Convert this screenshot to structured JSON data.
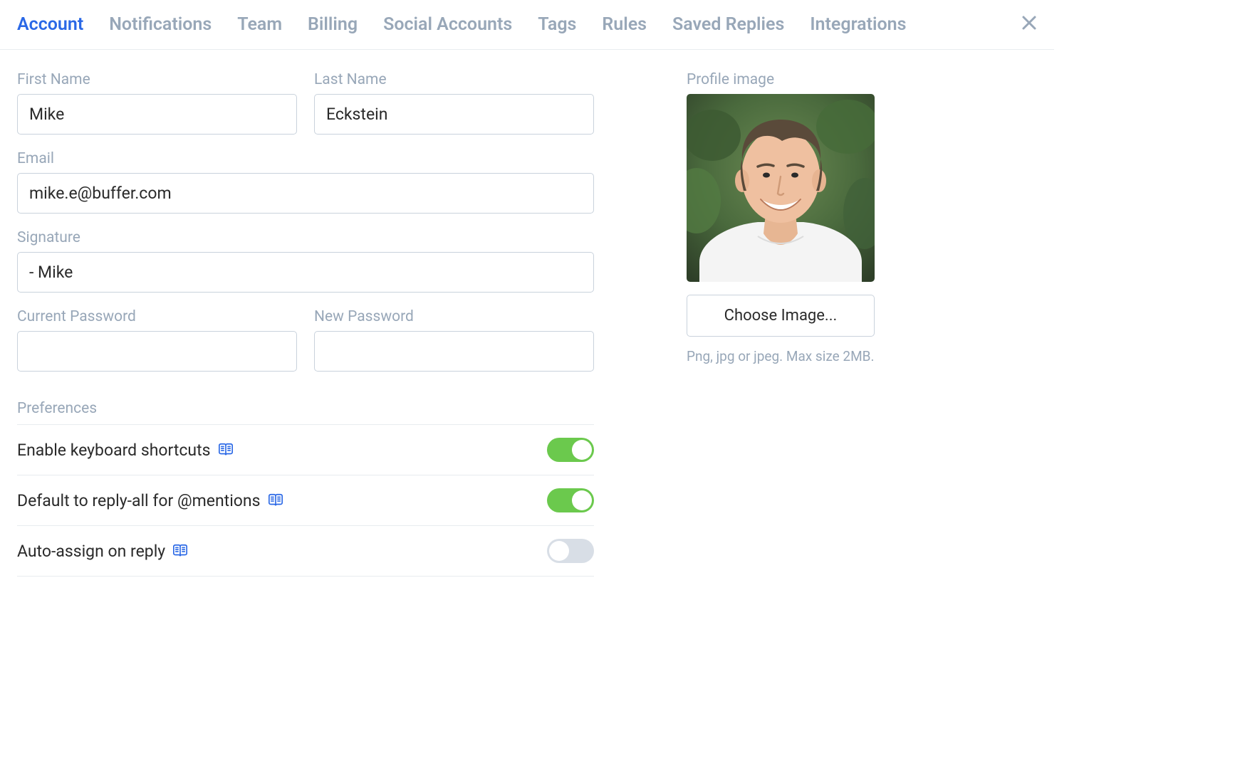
{
  "tabs": {
    "account": "Account",
    "notifications": "Notifications",
    "team": "Team",
    "billing": "Billing",
    "social": "Social Accounts",
    "tags": "Tags",
    "rules": "Rules",
    "saved_replies": "Saved Replies",
    "integrations": "Integrations"
  },
  "form": {
    "first_name_label": "First Name",
    "first_name_value": "Mike",
    "last_name_label": "Last Name",
    "last_name_value": "Eckstein",
    "email_label": "Email",
    "email_value": "mike.e@buffer.com",
    "signature_label": "Signature",
    "signature_value": "- Mike",
    "current_pw_label": "Current Password",
    "current_pw_value": "",
    "new_pw_label": "New Password",
    "new_pw_value": ""
  },
  "prefs": {
    "heading": "Preferences",
    "shortcuts": {
      "label": "Enable keyboard shortcuts",
      "on": true
    },
    "reply_all": {
      "label": "Default to reply-all for @mentions",
      "on": true
    },
    "auto_assign": {
      "label": "Auto-assign on reply",
      "on": false
    }
  },
  "profile": {
    "label": "Profile image",
    "choose_label": "Choose Image...",
    "hint": "Png, jpg or jpeg. Max size 2MB."
  }
}
